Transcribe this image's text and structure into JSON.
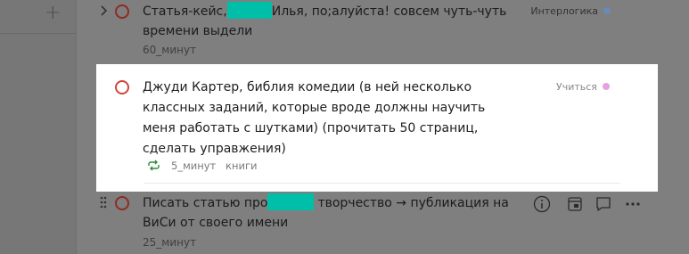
{
  "sidebar": {
    "add_symbol": "+"
  },
  "tasks": [
    {
      "title_before": "Статья-кейс,",
      "title_after": "Илья, по;алуйста! совсем чуть-чуть",
      "title_line2": "времени выдели",
      "labels": "60_минут",
      "project": "Интерлогика",
      "project_color": "#6b88b6"
    },
    {
      "title_lines": [
        "Джуди Картер, библия комедии (в ней несколько",
        "классных заданий, которые вроде должны научить",
        "меня работать с шутками) (прочитать 50 страниц,",
        "сделать управжения)"
      ],
      "labels": [
        "5_минут",
        "книги"
      ],
      "project": "Учиться",
      "project_color": "#e2a2e0"
    },
    {
      "title_before": "Писать статью про",
      "title_after": "творчество → публикация на",
      "title_line2": "ВиСи от своего имени",
      "labels": "25_минут"
    }
  ],
  "colors": {
    "priority_red": "#d1453b",
    "accent_green": "#2e8b3a",
    "redaction": "#00bfa8"
  },
  "icons": [
    "chevron-right-icon",
    "plus-icon",
    "recurring-icon",
    "drag-handle-icon",
    "info-icon",
    "schedule-icon",
    "comment-icon",
    "more-icon"
  ]
}
